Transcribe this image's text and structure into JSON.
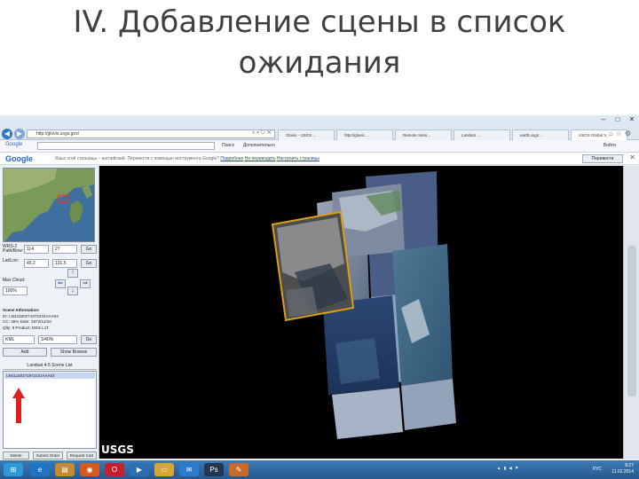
{
  "slide": {
    "title_line1": "IV. Добавление сцены в список",
    "title_line2": "ожидания"
  },
  "browser": {
    "url": "http://glovis.usgs.gov/",
    "tabs": [
      {
        "label": "Glovis - USGS ...",
        "active": false
      },
      {
        "label": "http://glovis ...",
        "active": false
      },
      {
        "label": "Remote Sens...",
        "active": false
      },
      {
        "label": "Landsat ...",
        "active": false
      },
      {
        "label": "earth.usgs...",
        "active": false
      },
      {
        "label": "USGS Global V...",
        "active": true
      }
    ],
    "search_brand": "Google",
    "google_items": [
      "Поиск",
      "Дополнительно",
      "Войти"
    ],
    "translate_bar": {
      "logo": "Google",
      "text": "Язык этой страницы – английский. Перевести с помощью инструмента Google?",
      "link1": "Подробнее",
      "link2": "Не переводить",
      "link3": "Настроить страницы",
      "button": "Перевести"
    }
  },
  "panel": {
    "wrs_label": "WRS-2 Path/Row:",
    "path": "114",
    "row": "27",
    "go1": "Go",
    "lat_label": "Lat/Lon:",
    "lat": "45.2",
    "lon": "131.5",
    "go2": "Go",
    "maxcloud_label": "Max Cloud:",
    "maxcloud": "100%",
    "scene_info_title": "Scene Information:",
    "scene_id": "ID: LM11150271972241AAA04",
    "scene_date": "CC: 45%  Date: 1972/12/10",
    "scene_qlty": "Qlty: 9   Product: MSS L1T",
    "resolution_select": "KML",
    "source_select": "1/40%",
    "go3": "Go",
    "add_button": "Add",
    "show_browse_button": "Show Browse",
    "scene_list_title": "Landsat 4-5 Scene List",
    "scene_list": [
      "LM11150271972241AAA04"
    ],
    "bottom_buttons": [
      "Delete",
      "Submit Order",
      "Request Cart"
    ]
  },
  "map": {
    "logo": "USGS"
  },
  "taskbar": {
    "apps": [
      "start",
      "ie",
      "explorer",
      "firefox",
      "opera",
      "media",
      "folder",
      "outlook",
      "photoshop",
      "paint"
    ],
    "tray_time": "8:27",
    "tray_date": "11.02.2014",
    "lang": "РУС"
  },
  "colors": {
    "accent": "#2f77c6",
    "scene_highlight": "#d9a016",
    "arrow": "#e02020"
  }
}
